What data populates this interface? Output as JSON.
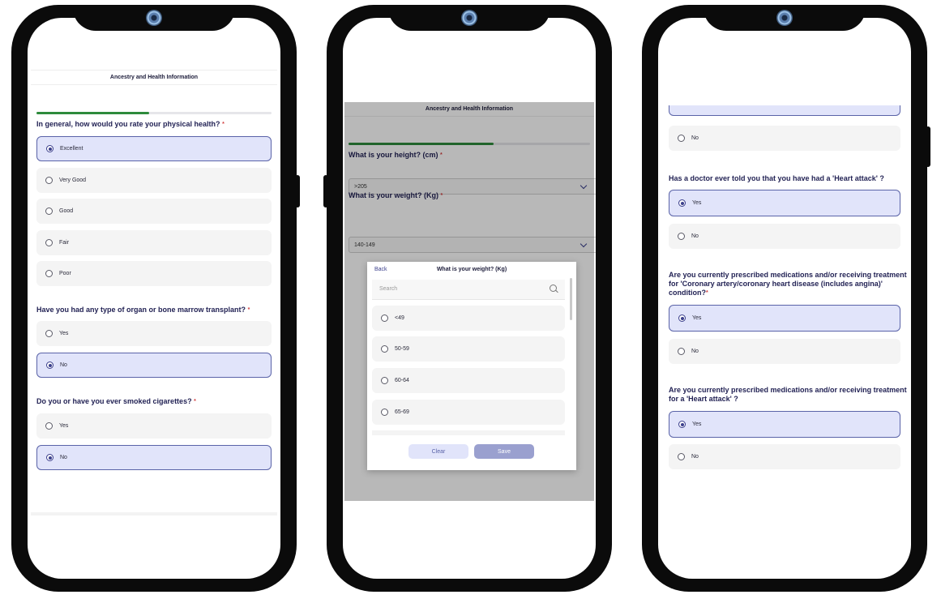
{
  "phone1": {
    "header": "Ancestry and Health Information",
    "progress": 0.48,
    "q1": {
      "text": "In general, how would you rate your physical health?",
      "required": "*",
      "options": [
        "Excellent",
        "Very Good",
        "Good",
        "Fair",
        "Poor"
      ],
      "selected": "Excellent"
    },
    "q2": {
      "text": "Have you had any type of organ or bone marrow transplant?",
      "required": "*",
      "options": [
        "Yes",
        "No"
      ],
      "selected": "No"
    },
    "q3": {
      "text": "Do you or have you ever smoked cigarettes?",
      "required": "*",
      "options": [
        "Yes",
        "No"
      ],
      "selected": "No"
    }
  },
  "phone2": {
    "header": "Ancestry and Health Information",
    "progress": 0.6,
    "height": {
      "label": "What is your height? (cm)",
      "required": "*",
      "value": ">205"
    },
    "weight": {
      "label": "What is your weight? (Kg)",
      "required": "*",
      "value": "140-149"
    },
    "modal": {
      "back": "Back",
      "title": "What is your weight? (Kg)",
      "search_placeholder": "Search",
      "options": [
        "<49",
        "50-59",
        "60-64",
        "65-69"
      ],
      "clear": "Clear",
      "save": "Save"
    }
  },
  "phone3": {
    "top_option": "No",
    "q1": {
      "text": "Has a doctor ever told you that you have had a 'Heart attack' ?",
      "options": [
        "Yes",
        "No"
      ],
      "selected": "Yes"
    },
    "q2": {
      "text": "Are you currently prescribed medications and/or receiving treatment for 'Coronary artery/coronary heart disease (includes angina)' condition?",
      "required": "*",
      "options": [
        "Yes",
        "No"
      ],
      "selected": "Yes"
    },
    "q3": {
      "text": "Are you currently prescribed medications and/or receiving treatment for a 'Heart attack' ?",
      "options": [
        "Yes",
        "No"
      ],
      "selected": "Yes"
    }
  },
  "colors": {
    "accent": "#3b3f8c",
    "selected_bg": "#e1e4fa",
    "progress": "#2e8b3c",
    "required": "#d23d3d"
  }
}
